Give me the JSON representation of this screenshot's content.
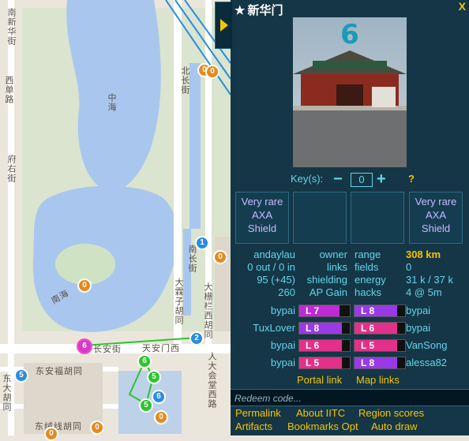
{
  "map": {
    "lake_labels": [
      "中海",
      "南海"
    ],
    "road_labels": [
      "北长街",
      "大霖子胡同",
      "南长街",
      "大栅栏西胡同",
      "南新华街",
      "府右街",
      "西单路",
      "东安福胡同",
      "东绒线胡同",
      "长安街",
      "天安门西",
      "人大会堂西路",
      "东大胡同"
    ],
    "portals": [
      {
        "level": "0",
        "color": "#e58a1e"
      },
      {
        "level": "0",
        "color": "#e58a1e"
      },
      {
        "level": "1",
        "color": "#2a8de0"
      },
      {
        "level": "0",
        "color": "#e58a1e"
      },
      {
        "level": "0",
        "color": "#e58a1e"
      },
      {
        "level": "6",
        "color": "#d13cc6"
      },
      {
        "level": "2",
        "color": "#2a8de0"
      },
      {
        "level": "5",
        "color": "#2a8de0"
      },
      {
        "level": "6",
        "color": "#2ec42e"
      },
      {
        "level": "5",
        "color": "#2ec42e"
      },
      {
        "level": "6",
        "color": "#2a8de0"
      },
      {
        "level": "5",
        "color": "#2ec42e"
      },
      {
        "level": "0",
        "color": "#e58a1e"
      },
      {
        "level": "0",
        "color": "#e58a1e"
      },
      {
        "level": "0",
        "color": "#e58a1e"
      }
    ]
  },
  "panel": {
    "title": "新华门",
    "close": "X",
    "level": "6",
    "keys_label": "Key(s):",
    "keys_minus": "−",
    "keys_value": "0",
    "keys_plus": "+",
    "keys_help": "?",
    "mods": [
      {
        "rarity": "Very rare",
        "name": "AXA",
        "type": "Shield"
      },
      {
        "rarity": "",
        "name": "",
        "type": ""
      },
      {
        "rarity": "",
        "name": "",
        "type": ""
      },
      {
        "rarity": "Very rare",
        "name": "AXA",
        "type": "Shield"
      }
    ],
    "stats": {
      "owner_value": "andaylau",
      "owner_label": "owner",
      "range_label": "range",
      "range_value": "308 km",
      "links_value": "0 out / 0 in",
      "links_label": "links",
      "fields_label": "fields",
      "fields_value": "0",
      "shielding_value": "95 (+45)",
      "shielding_label": "shielding",
      "energy_label": "energy",
      "energy_value": "31 k / 37 k",
      "apgain_value": "260",
      "apgain_label": "AP Gain",
      "hacks_label": "hacks",
      "hacks_value": "4 @ 5m"
    },
    "resonators": [
      {
        "left_owner": "bypai",
        "left_level": "L 7",
        "left_fill": 0.8,
        "left_color": "#c229d6",
        "right_level": "L 8",
        "right_fill": 0.85,
        "right_color": "#9a3ae6",
        "right_owner": "bypai"
      },
      {
        "left_owner": "TuxLover",
        "left_level": "L 8",
        "left_fill": 0.85,
        "left_color": "#9a3ae6",
        "right_level": "L 6",
        "right_fill": 0.85,
        "right_color": "#e3308a",
        "right_owner": "bypai"
      },
      {
        "left_owner": "bypai",
        "left_level": "L 6",
        "left_fill": 0.85,
        "left_color": "#e3308a",
        "right_level": "L 5",
        "right_fill": 0.85,
        "right_color": "#e3308a",
        "right_owner": "VanSong"
      },
      {
        "left_owner": "bypai",
        "left_level": "L 5",
        "left_fill": 0.85,
        "left_color": "#e3308a",
        "right_level": "L 8",
        "right_fill": 0.85,
        "right_color": "#9a3ae6",
        "right_owner": "alessa82"
      }
    ],
    "portal_link": "Portal link",
    "map_links": "Map links",
    "redeem_placeholder": "Redeem code...",
    "footer_links": [
      "Permalink",
      "About IITC",
      "Region scores",
      "Artifacts",
      "Bookmarks Opt",
      "Auto draw"
    ]
  },
  "colors": {
    "accent": "#f5c400",
    "text": "#61d5ea",
    "panel_bg": "#04283a"
  }
}
